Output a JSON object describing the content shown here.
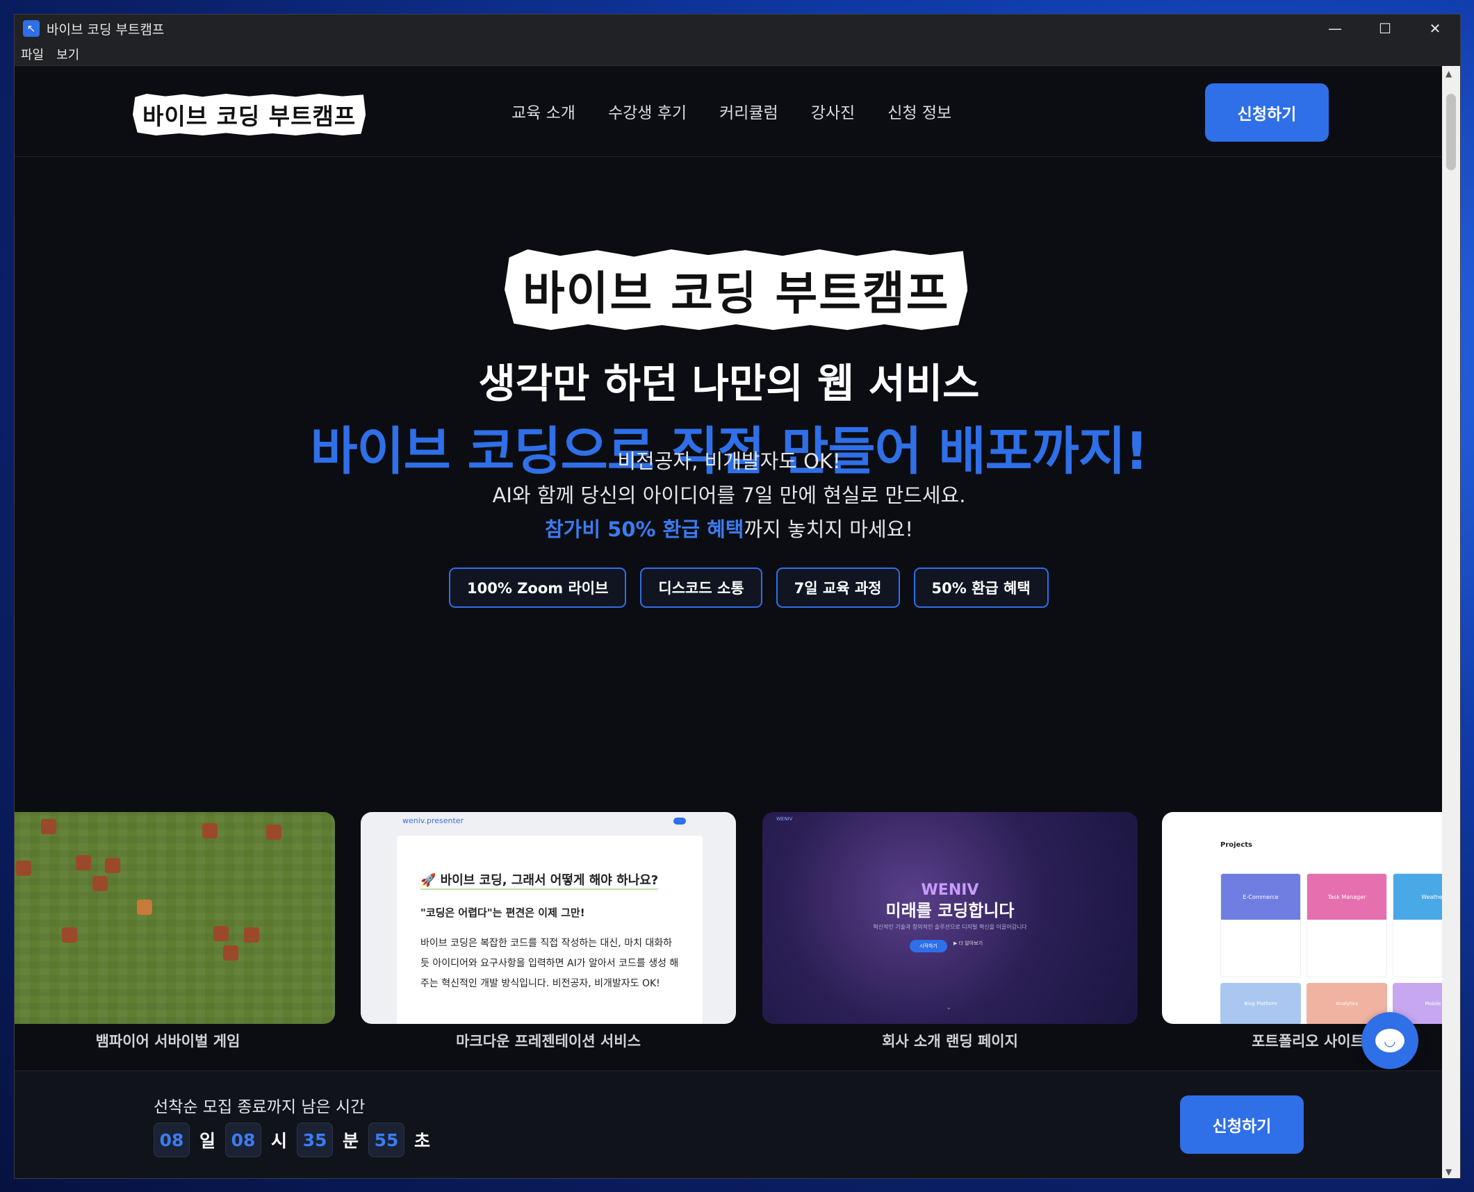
{
  "window": {
    "title": "바이브 코딩 부트캠프",
    "menu": [
      "파일",
      "보기"
    ],
    "controls": {
      "minimize": "—",
      "maximize": "☐",
      "close": "✕"
    }
  },
  "nav": {
    "logo": "바이브 코딩 부트캠프",
    "links": [
      "교육 소개",
      "수강생 후기",
      "커리큘럼",
      "강사진",
      "신청 정보"
    ],
    "cta": "신청하기"
  },
  "hero": {
    "logo": "바이브 코딩 부트캠프",
    "headline1": "생각만 하던 나만의 웹 서비스",
    "headline2": "바이브 코딩으로 직접 만들어 배포까지!",
    "sub1": "비전공자, 비개발자도 OK!",
    "sub2": "AI와 함께 당신의 아이디어를 7일 만에 현실로 만드세요.",
    "sub3_highlight": "참가비 50% 환급 혜택",
    "sub3_rest": "까지 놓치지 마세요!",
    "tags": [
      "100% Zoom 라이브",
      "디스코드 소통",
      "7일 교육 과정",
      "50% 환급 혜택"
    ]
  },
  "cards": [
    {
      "caption": "뱀파이어 서바이벌 게임"
    },
    {
      "caption": "마크다운 프레젠테이션 서비스",
      "brand": "weniv.presenter",
      "heading": "🚀 바이브 코딩, 그래서 어떻게 해야 하나요?",
      "subheading": "\"코딩은 어렵다\"는 편견은 이제 그만!",
      "body": "바이브 코딩은 복잡한 코드를 직접 작성하는 대신, 마치 대화하듯 아이디어와 요구사항을 입력하면 AI가 알아서 코드를 생성 해 주는 혁신적인 개발 방식입니다. 비전공자, 비개발자도 OK!"
    },
    {
      "caption": "회사 소개 랜딩 페이지",
      "brand": "WENIV",
      "tagline": "미래를 코딩합니다",
      "desc": "혁신적인 기술과 창의적인 솔루션으로 디지털 혁신을 이끌어갑니다",
      "btn1": "시작하기",
      "btn2": "▶ 더 알아보기"
    },
    {
      "caption": "포트폴리오 사이트",
      "heading": "Projects",
      "projects": [
        {
          "name": "E-Commerce",
          "color": "#6f7ee0"
        },
        {
          "name": "Task Manager",
          "color": "#e66fb0"
        },
        {
          "name": "Weather",
          "color": "#49a8e6"
        }
      ],
      "row2": [
        {
          "name": "Blog Platform",
          "color": "#a9c7f0"
        },
        {
          "name": "Analytics",
          "color": "#f0b3a2"
        },
        {
          "name": "Mobile",
          "color": "#c7a8f0"
        }
      ]
    }
  ],
  "countdown": {
    "label": "선착순 모집 종료까지 남은 시간",
    "days": "08",
    "days_unit": "일",
    "hours": "08",
    "hours_unit": "시",
    "minutes": "35",
    "minutes_unit": "분",
    "seconds": "55",
    "seconds_unit": "초",
    "cta": "신청하기"
  },
  "colors": {
    "accent": "#2f6fe8",
    "background": "#0b0d12"
  }
}
